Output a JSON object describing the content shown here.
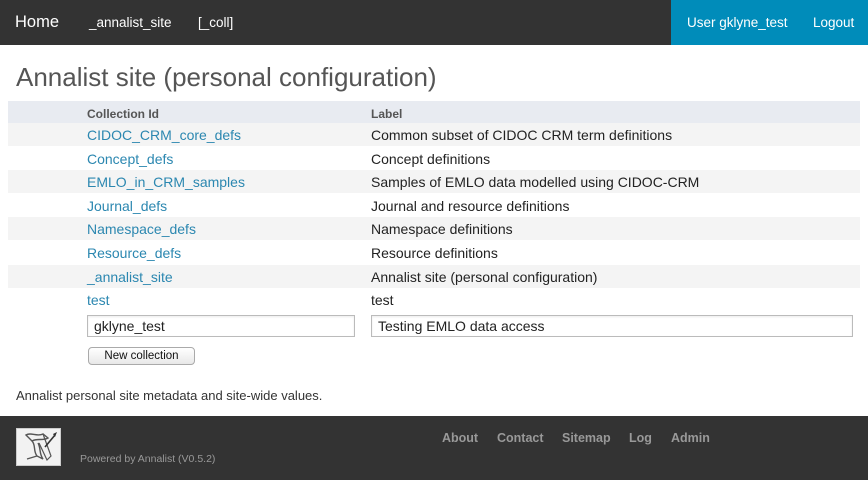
{
  "topbar": {
    "home": "Home",
    "site": "_annalist_site",
    "coll": "[_coll]",
    "user": "User gklyne_test",
    "logout": "Logout"
  },
  "page_title": "Annalist site (personal configuration)",
  "table": {
    "headers": {
      "id": "Collection Id",
      "label": "Label"
    },
    "rows": [
      {
        "id": "CIDOC_CRM_core_defs",
        "label": "Common subset of CIDOC CRM term definitions"
      },
      {
        "id": "Concept_defs",
        "label": "Concept definitions"
      },
      {
        "id": "EMLO_in_CRM_samples",
        "label": "Samples of EMLO data modelled using CIDOC-CRM"
      },
      {
        "id": "Journal_defs",
        "label": "Journal and resource definitions"
      },
      {
        "id": "Namespace_defs",
        "label": "Namespace definitions"
      },
      {
        "id": "Resource_defs",
        "label": "Resource definitions"
      },
      {
        "id": "_annalist_site",
        "label": "Annalist site (personal configuration)"
      },
      {
        "id": "test",
        "label": "test"
      }
    ]
  },
  "new_collection": {
    "id_value": "gklyne_test",
    "label_value": "Testing EMLO data access",
    "button": "New collection"
  },
  "meta_text": "Annalist personal site metadata and site-wide values.",
  "footer": {
    "powered": "Powered by Annalist (V0.5.2)",
    "links": [
      "About",
      "Contact",
      "Sitemap",
      "Log",
      "Admin"
    ]
  },
  "colors": {
    "topbar": "#333333",
    "accent": "#008cba",
    "link": "#2b87b0",
    "header_bg": "#e8ebf1"
  }
}
